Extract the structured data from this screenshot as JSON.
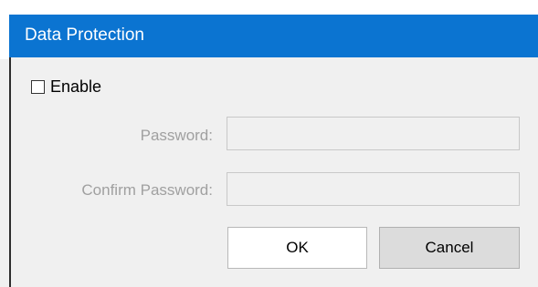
{
  "window": {
    "title": "Data Protection"
  },
  "enable": {
    "label": "Enable",
    "checked": false
  },
  "password": {
    "label": "Password:",
    "value": ""
  },
  "confirm_password": {
    "label": "Confirm Password:",
    "value": ""
  },
  "buttons": {
    "ok_label": "OK",
    "cancel_label": "Cancel"
  },
  "colors": {
    "titlebar": "#0b74d1",
    "dialog_bg": "#f0f0f0",
    "disabled_text": "#a0a0a0"
  }
}
